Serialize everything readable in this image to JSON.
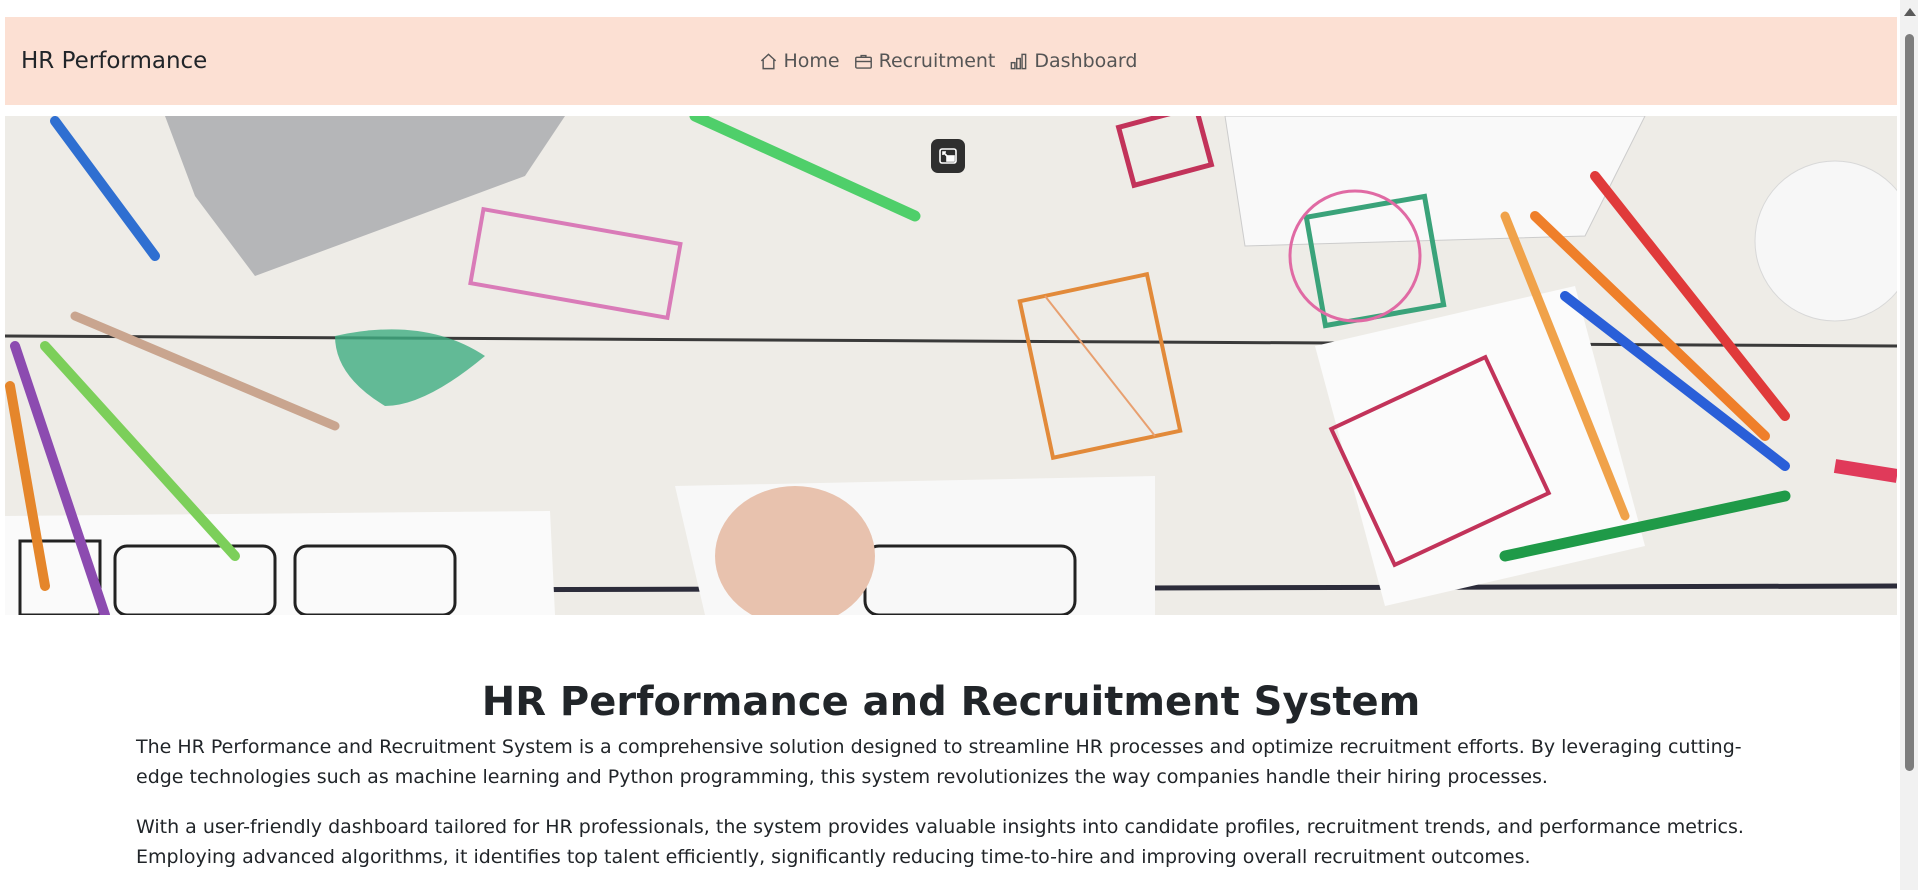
{
  "navbar": {
    "brand": "HR Performance",
    "links": [
      {
        "label": "Home",
        "icon": "house-icon"
      },
      {
        "label": "Recruitment",
        "icon": "briefcase-icon"
      },
      {
        "label": "Dashboard",
        "icon": "bar-chart-icon"
      }
    ],
    "background": "#fce0d3"
  },
  "hero": {
    "overlay_button_icon": "picture-in-picture-icon"
  },
  "main": {
    "title": "HR Performance and Recruitment System",
    "paragraphs": [
      "The HR Performance and Recruitment System is a comprehensive solution designed to streamline HR processes and optimize recruitment efforts. By leveraging cutting-edge technologies such as machine learning and Python programming, this system revolutionizes the way companies handle their hiring processes.",
      "With a user-friendly dashboard tailored for HR professionals, the system provides valuable insights into candidate profiles, recruitment trends, and performance metrics. Employing advanced algorithms, it identifies top talent efficiently, significantly reducing time-to-hire and improving overall recruitment outcomes."
    ]
  }
}
